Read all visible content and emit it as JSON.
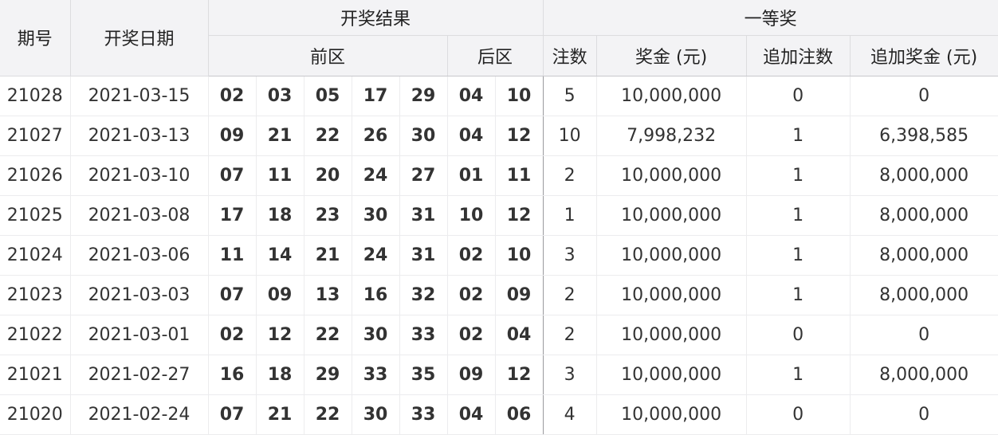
{
  "headers": {
    "period": "期号",
    "date": "开奖日期",
    "result": "开奖结果",
    "first_prize": "一等奖",
    "front_zone": "前区",
    "back_zone": "后区",
    "winners": "注数",
    "prize": "奖金 (元)",
    "extra_winners": "追加注数",
    "extra_prize": "追加奖金 (元)"
  },
  "rows": [
    {
      "period": "21028",
      "date": "2021-03-15",
      "front": [
        "02",
        "03",
        "05",
        "17",
        "29"
      ],
      "back": [
        "04",
        "10"
      ],
      "winners": "5",
      "prize": "10,000,000",
      "extra_winners": "0",
      "extra_prize": "0"
    },
    {
      "period": "21027",
      "date": "2021-03-13",
      "front": [
        "09",
        "21",
        "22",
        "26",
        "30"
      ],
      "back": [
        "04",
        "12"
      ],
      "winners": "10",
      "prize": "7,998,232",
      "extra_winners": "1",
      "extra_prize": "6,398,585"
    },
    {
      "period": "21026",
      "date": "2021-03-10",
      "front": [
        "07",
        "11",
        "20",
        "24",
        "27"
      ],
      "back": [
        "01",
        "11"
      ],
      "winners": "2",
      "prize": "10,000,000",
      "extra_winners": "1",
      "extra_prize": "8,000,000"
    },
    {
      "period": "21025",
      "date": "2021-03-08",
      "front": [
        "17",
        "18",
        "23",
        "30",
        "31"
      ],
      "back": [
        "10",
        "12"
      ],
      "winners": "1",
      "prize": "10,000,000",
      "extra_winners": "1",
      "extra_prize": "8,000,000"
    },
    {
      "period": "21024",
      "date": "2021-03-06",
      "front": [
        "11",
        "14",
        "21",
        "24",
        "31"
      ],
      "back": [
        "02",
        "10"
      ],
      "winners": "3",
      "prize": "10,000,000",
      "extra_winners": "1",
      "extra_prize": "8,000,000"
    },
    {
      "period": "21023",
      "date": "2021-03-03",
      "front": [
        "07",
        "09",
        "13",
        "16",
        "32"
      ],
      "back": [
        "02",
        "09"
      ],
      "winners": "2",
      "prize": "10,000,000",
      "extra_winners": "1",
      "extra_prize": "8,000,000"
    },
    {
      "period": "21022",
      "date": "2021-03-01",
      "front": [
        "02",
        "12",
        "22",
        "30",
        "33"
      ],
      "back": [
        "02",
        "04"
      ],
      "winners": "2",
      "prize": "10,000,000",
      "extra_winners": "0",
      "extra_prize": "0"
    },
    {
      "period": "21021",
      "date": "2021-02-27",
      "front": [
        "16",
        "18",
        "29",
        "33",
        "35"
      ],
      "back": [
        "09",
        "12"
      ],
      "winners": "3",
      "prize": "10,000,000",
      "extra_winners": "1",
      "extra_prize": "8,000,000"
    },
    {
      "period": "21020",
      "date": "2021-02-24",
      "front": [
        "07",
        "21",
        "22",
        "30",
        "33"
      ],
      "back": [
        "04",
        "06"
      ],
      "winners": "4",
      "prize": "10,000,000",
      "extra_winners": "0",
      "extra_prize": "0"
    }
  ],
  "colors": {
    "front_number": "#2b86d6",
    "back_number": "#ee7d1a",
    "header_bg": "#f3f3f5"
  }
}
